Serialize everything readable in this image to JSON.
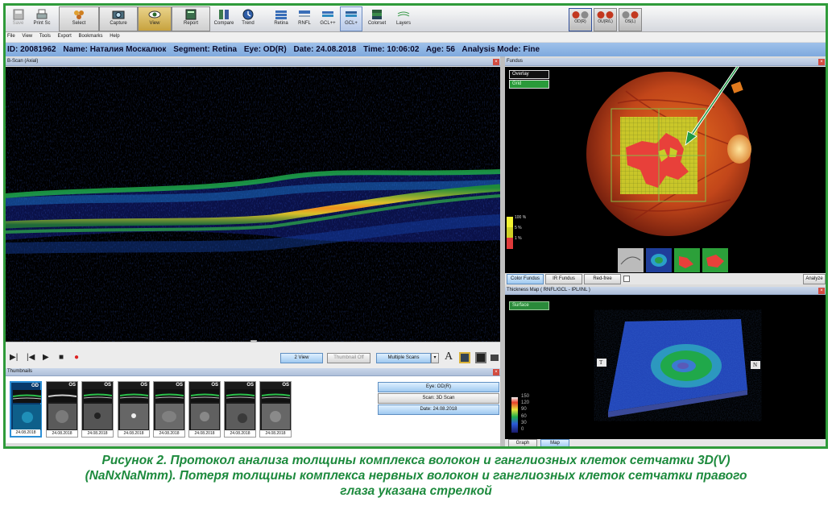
{
  "toolbar": {
    "items": [
      {
        "label": "Save",
        "icon": "save-icon"
      },
      {
        "label": "Print Sc",
        "icon": "printer-icon"
      },
      {
        "label": "Select",
        "icon": "select-icon"
      },
      {
        "label": "Capture",
        "icon": "camera-icon"
      },
      {
        "label": "View",
        "icon": "eye-icon"
      },
      {
        "label": "Report",
        "icon": "report-icon"
      },
      {
        "label": "Compare",
        "icon": "compare-icon"
      },
      {
        "label": "Trend",
        "icon": "trend-icon"
      },
      {
        "label": "Retina",
        "icon": "retina-layer-icon"
      },
      {
        "label": "RNFL",
        "icon": "rnfl-layer-icon"
      },
      {
        "label": "GCL++",
        "icon": "gclpp-layer-icon"
      },
      {
        "label": "GCL+",
        "icon": "gclp-layer-icon"
      },
      {
        "label": "Colorset",
        "icon": "colorset-icon"
      },
      {
        "label": "Layers",
        "icon": "layers-icon"
      }
    ],
    "eyes": [
      {
        "label": "OD(R)"
      },
      {
        "label": "OU(R/L)"
      },
      {
        "label": "OS(L)"
      }
    ]
  },
  "menu": [
    "File",
    "View",
    "Tools",
    "Export",
    "Bookmarks",
    "Help"
  ],
  "patient": {
    "id": "ID: 20081962",
    "name": "Name: Наталия Москалюк",
    "segment": "Segment: Retina",
    "eye": "Eye: OD(R)",
    "date": "Date: 24.08.2018",
    "time": "Time: 10:06:02",
    "age": "Age: 56",
    "mode": "Analysis Mode: Fine"
  },
  "bscan": {
    "title": "B-Scan (Axial)",
    "buttons": {
      "two_view": "2 View",
      "thumbnail_off": "Thumbnail Off",
      "multiple_scans": "Multiple Scans"
    },
    "font_glyph": "A"
  },
  "thumbnails": {
    "title": "Thumbnails",
    "items": [
      {
        "eye": "OD",
        "date": "24.08.2018"
      },
      {
        "eye": "OS",
        "date": "24.08.2018"
      },
      {
        "eye": "OS",
        "date": "24.08.2018"
      },
      {
        "eye": "OS",
        "date": "24.08.2018"
      },
      {
        "eye": "OS",
        "date": "24.08.2018"
      },
      {
        "eye": "OS",
        "date": "24.08.2018"
      },
      {
        "eye": "OS",
        "date": "24.08.2018"
      },
      {
        "eye": "OS",
        "date": "24.08.2018"
      }
    ],
    "info": {
      "eye": "Eye: OD(R)",
      "scan": "Scan: 3D Scan",
      "date": "Date: 24.08.2018"
    }
  },
  "fundus": {
    "title": "Fundus",
    "overlay_label": "Overlay",
    "grid_label": "Grid",
    "legend": [
      "100 %",
      "5 %",
      "1 %"
    ],
    "legend_colors": [
      "#f2f230",
      "#cfcf25",
      "#e03a3a"
    ],
    "tabs": [
      "Color Fundus",
      "IR Fundus",
      "Red-free"
    ],
    "analyze": "Analyze"
  },
  "thickness": {
    "title": "Thickness Map  ( RNFL/GCL - IPL/INL )",
    "surface_label": "Surface",
    "scale": [
      "150",
      "120",
      "90",
      "60",
      "30",
      "0"
    ],
    "markers": {
      "left": "T",
      "right": "N"
    },
    "tabs": [
      "Graph",
      "Map"
    ]
  },
  "caption": {
    "line1": "Рисунок 2. Протокол анализа толщины комплекса волокон и ганглиозных клеток сетчатки 3D(V)",
    "line2": "(NaNxNaNmm). Потеря толщины комплекса нервных волокон и ганглиозных клеток сетчатки правого",
    "line3": "глаза указана стрелкой"
  },
  "colors": {
    "frame": "#2f9b3a",
    "caption": "#1d8a3d",
    "arrow": "#1e9a45"
  }
}
